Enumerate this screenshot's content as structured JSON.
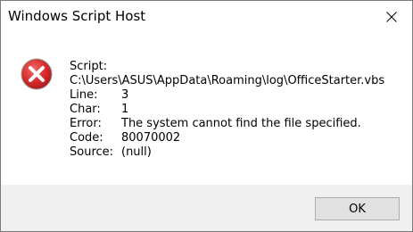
{
  "window": {
    "title": "Windows Script Host"
  },
  "icons": {
    "error": "error-x-circle-icon",
    "close": "close-icon"
  },
  "colors": {
    "error_red": "#d42b2b",
    "footer_bg": "#f0f0f0",
    "button_bg": "#e1e1e1"
  },
  "message": {
    "script_label": "Script:",
    "script_path": "C:\\Users\\ASUS\\AppData\\Roaming\\log\\OfficeStarter.vbs",
    "line_label": "Line:",
    "line_value": "3",
    "char_label": "Char:",
    "char_value": "1",
    "error_label": "Error:",
    "error_value": "The system cannot find the file specified.",
    "code_label": "Code:",
    "code_value": "80070002",
    "source_label": "Source:",
    "source_value": "(null)"
  },
  "buttons": {
    "ok_label": "OK"
  }
}
